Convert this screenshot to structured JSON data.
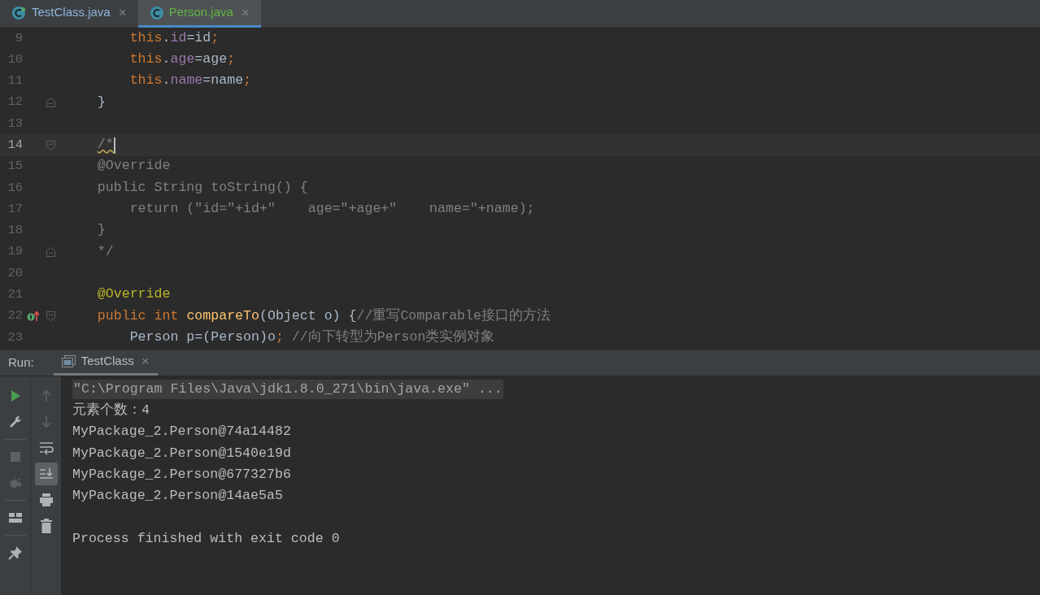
{
  "editor_tabs": [
    {
      "label": "TestClass.java",
      "selected": false,
      "color": "#8eb4dc",
      "runnable": true,
      "close": "×"
    },
    {
      "label": "Person.java",
      "selected": true,
      "color": "#62b543",
      "runnable": false,
      "close": "×"
    }
  ],
  "code_lines": [
    {
      "number": "9",
      "current": false,
      "fold_start": false,
      "fold_end": false,
      "implements_marker": false,
      "tokens": [
        {
          "t": "        this",
          "kind": "keyword"
        },
        {
          "t": ".",
          "kind": "plain"
        },
        {
          "t": "id",
          "kind": "field"
        },
        {
          "t": "=id",
          "kind": "plain"
        },
        {
          "t": ";",
          "kind": "keyword"
        }
      ]
    },
    {
      "number": "10",
      "current": false,
      "fold_start": false,
      "fold_end": false,
      "implements_marker": false,
      "tokens": [
        {
          "t": "        this",
          "kind": "keyword"
        },
        {
          "t": ".",
          "kind": "plain"
        },
        {
          "t": "age",
          "kind": "field"
        },
        {
          "t": "=age",
          "kind": "plain"
        },
        {
          "t": ";",
          "kind": "keyword"
        }
      ]
    },
    {
      "number": "11",
      "current": false,
      "fold_start": false,
      "fold_end": false,
      "implements_marker": false,
      "tokens": [
        {
          "t": "        this",
          "kind": "keyword"
        },
        {
          "t": ".",
          "kind": "plain"
        },
        {
          "t": "name",
          "kind": "field"
        },
        {
          "t": "=name",
          "kind": "plain"
        },
        {
          "t": ";",
          "kind": "keyword"
        }
      ]
    },
    {
      "number": "12",
      "current": false,
      "fold_start": false,
      "fold_end": true,
      "implements_marker": false,
      "tokens": [
        {
          "t": "    }",
          "kind": "plain"
        }
      ]
    },
    {
      "number": "13",
      "current": false,
      "fold_start": false,
      "fold_end": false,
      "implements_marker": false
    },
    {
      "number": "14",
      "current": true,
      "fold_start": true,
      "fold_end": false,
      "implements_marker": false,
      "tokens": [
        {
          "t": "    /*",
          "kind": "comment",
          "warning": true
        }
      ]
    },
    {
      "number": "15",
      "current": false,
      "fold_start": false,
      "fold_end": false,
      "implements_marker": false,
      "tokens": [
        {
          "t": "    @Override",
          "kind": "comment"
        }
      ]
    },
    {
      "number": "16",
      "current": false,
      "fold_start": false,
      "fold_end": false,
      "implements_marker": false,
      "tokens": [
        {
          "t": "    public String toString() {",
          "kind": "comment"
        }
      ]
    },
    {
      "number": "17",
      "current": false,
      "fold_start": false,
      "fold_end": false,
      "implements_marker": false,
      "tokens": [
        {
          "t": "        return (\"id=\"+id+\"    age=\"+age+\"    name=\"+name);",
          "kind": "comment"
        }
      ]
    },
    {
      "number": "18",
      "current": false,
      "fold_start": false,
      "fold_end": false,
      "implements_marker": false,
      "tokens": [
        {
          "t": "    }",
          "kind": "comment"
        }
      ]
    },
    {
      "number": "19",
      "current": false,
      "fold_start": false,
      "fold_end": true,
      "implements_marker": false,
      "tokens": [
        {
          "t": "    */",
          "kind": "comment"
        }
      ]
    },
    {
      "number": "20",
      "current": false,
      "fold_start": false,
      "fold_end": false,
      "implements_marker": false
    },
    {
      "number": "21",
      "current": false,
      "fold_start": false,
      "fold_end": false,
      "implements_marker": false,
      "tokens": [
        {
          "t": "    @Override",
          "kind": "annotation"
        }
      ]
    },
    {
      "number": "22",
      "current": false,
      "fold_start": true,
      "fold_end": false,
      "implements_marker": true,
      "tokens": [
        {
          "t": "    public int ",
          "kind": "keyword"
        },
        {
          "t": "compareTo",
          "kind": "method"
        },
        {
          "t": "(Object o) {",
          "kind": "plain"
        },
        {
          "t": "//重写Comparable接口的方法",
          "kind": "comment"
        }
      ]
    },
    {
      "number": "23",
      "current": false,
      "fold_start": false,
      "fold_end": false,
      "implements_marker": false,
      "tokens": [
        {
          "t": "        Person p=(Person)o",
          "kind": "plain"
        },
        {
          "t": "; ",
          "kind": "keyword"
        },
        {
          "t": "//向下转型为Person类实例对象",
          "kind": "comment"
        }
      ]
    }
  ],
  "run_panel": {
    "label": "Run:",
    "tab": {
      "label": "TestClass",
      "selected": true,
      "close": "×"
    },
    "toolbar_left": [
      {
        "kind": "run",
        "disabled": false
      },
      {
        "kind": "wrench",
        "disabled": false
      },
      {
        "kind": "separator"
      },
      {
        "kind": "stop",
        "disabled": true
      },
      {
        "kind": "bug",
        "disabled": true
      },
      {
        "kind": "separator"
      },
      {
        "kind": "layout",
        "disabled": false
      },
      {
        "kind": "separator"
      },
      {
        "kind": "pin",
        "disabled": false
      }
    ],
    "toolbar_right": [
      {
        "kind": "up",
        "disabled": true,
        "selected": false
      },
      {
        "kind": "down",
        "disabled": true,
        "selected": false
      },
      {
        "kind": "wrap",
        "disabled": false,
        "selected": false
      },
      {
        "kind": "scroll-end",
        "disabled": false,
        "selected": true
      },
      {
        "kind": "print",
        "disabled": false,
        "selected": false
      },
      {
        "kind": "trash",
        "disabled": false,
        "selected": false
      }
    ],
    "console": [
      {
        "text": "\"C:\\Program Files\\Java\\jdk1.8.0_271\\bin\\java.exe\" ...",
        "kind": "command"
      },
      {
        "text": "元素个数：4",
        "kind": "output"
      },
      {
        "text": "MyPackage_2.Person@74a14482",
        "kind": "output"
      },
      {
        "text": "MyPackage_2.Person@1540e19d",
        "kind": "output"
      },
      {
        "text": "MyPackage_2.Person@677327b6",
        "kind": "output"
      },
      {
        "text": "MyPackage_2.Person@14ae5a5",
        "kind": "output"
      },
      {
        "text": "Process finished with exit code 0",
        "kind": "output",
        "gap_before": true
      }
    ]
  }
}
